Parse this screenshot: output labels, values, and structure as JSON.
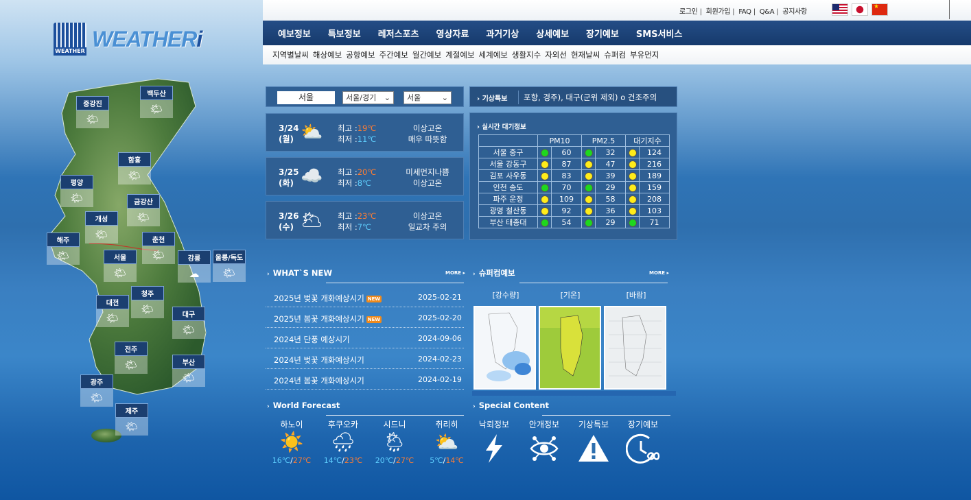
{
  "header": {
    "logo_text": "WEATHER",
    "logo_mark": "WEATHER",
    "util_links": [
      "로그인",
      "회원가입",
      "FAQ",
      "Q&A",
      "공지사항"
    ],
    "flags": [
      "us-flag",
      "jp-flag",
      "cn-flag"
    ]
  },
  "gnb": [
    "예보정보",
    "특보정보",
    "레저스포츠",
    "영상자료",
    "과거기상",
    "상세예보",
    "장기예보",
    "SMS서비스"
  ],
  "subnav": [
    "지역별날씨",
    "해상예보",
    "공항예보",
    "주간예보",
    "월간예보",
    "계절예보",
    "세계예보",
    "생활지수",
    "자외선",
    "현재날씨",
    "슈퍼컴",
    "부유먼지"
  ],
  "map_cities": [
    {
      "name": "중강진"
    },
    {
      "name": "백두산"
    },
    {
      "name": "함흥"
    },
    {
      "name": "평양"
    },
    {
      "name": "금강산"
    },
    {
      "name": "개성"
    },
    {
      "name": "해주"
    },
    {
      "name": "춘천"
    },
    {
      "name": "서울"
    },
    {
      "name": "강릉"
    },
    {
      "name": "울릉/독도"
    },
    {
      "name": "청주"
    },
    {
      "name": "대전"
    },
    {
      "name": "대구"
    },
    {
      "name": "전주"
    },
    {
      "name": "부산"
    },
    {
      "name": "광주"
    },
    {
      "name": "제주"
    }
  ],
  "location": {
    "city": "서울",
    "region_select": "서울/경기",
    "city_select": "서울"
  },
  "forecast_days": [
    {
      "date": "3/24",
      "weekday": "(월)",
      "icon": "partly-cloudy-icon",
      "hi_label": "최고 :",
      "hi": "19℃",
      "lo_label": "최저 :",
      "lo": "11℃",
      "desc1": "이상고온",
      "desc2": "매우 따뜻함"
    },
    {
      "date": "3/25",
      "weekday": "(화)",
      "icon": "cloudy-icon",
      "hi_label": "최고 :",
      "hi": "20℃",
      "lo_label": "최저 :",
      "lo": "8℃",
      "desc1": "미세먼지나쁨",
      "desc2": "이상고온"
    },
    {
      "date": "3/26",
      "weekday": "(수)",
      "icon": "sun-cloud-icon",
      "hi_label": "최고 :",
      "hi": "23℃",
      "lo_label": "최저 :",
      "lo": "7℃",
      "desc1": "이상고온",
      "desc2": "일교차 주의"
    }
  ],
  "alert": {
    "tag": "기상특보",
    "text": "포항, 경주), 대구(군위 제외) o 건조주의"
  },
  "air": {
    "title": "실시간 대기정보",
    "headers": [
      "PM10",
      "PM2.5",
      "대기지수"
    ],
    "rows": [
      {
        "place": "서울 중구",
        "pm10": "60",
        "pm10_c": "g",
        "pm25": "32",
        "pm25_c": "g",
        "aqi": "124",
        "aqi_c": "y"
      },
      {
        "place": "서울 강동구",
        "pm10": "87",
        "pm10_c": "y",
        "pm25": "47",
        "pm25_c": "y",
        "aqi": "216",
        "aqi_c": "y"
      },
      {
        "place": "김포 사우동",
        "pm10": "83",
        "pm10_c": "y",
        "pm25": "39",
        "pm25_c": "y",
        "aqi": "189",
        "aqi_c": "y"
      },
      {
        "place": "인천 송도",
        "pm10": "70",
        "pm10_c": "g",
        "pm25": "29",
        "pm25_c": "g",
        "aqi": "159",
        "aqi_c": "y"
      },
      {
        "place": "파주 운정",
        "pm10": "109",
        "pm10_c": "y",
        "pm25": "58",
        "pm25_c": "y",
        "aqi": "208",
        "aqi_c": "y"
      },
      {
        "place": "광명 철산동",
        "pm10": "92",
        "pm10_c": "y",
        "pm25": "36",
        "pm25_c": "y",
        "aqi": "103",
        "aqi_c": "y"
      },
      {
        "place": "부산 태종대",
        "pm10": "54",
        "pm10_c": "g",
        "pm25": "29",
        "pm25_c": "g",
        "aqi": "71",
        "aqi_c": "g"
      }
    ]
  },
  "whats_new": {
    "title": "WHAT`S NEW",
    "more": "MORE",
    "items": [
      {
        "title": "2025년 벚꽃 개화예상시기",
        "new": "NEW",
        "date": "2025-02-21"
      },
      {
        "title": "2025년 봄꽃 개화예상시기",
        "new": "NEW",
        "date": "2025-02-20"
      },
      {
        "title": "2024년 단풍 예상시기",
        "new": "",
        "date": "2024-09-06"
      },
      {
        "title": "2024년 벚꽃 개화예상시기",
        "new": "",
        "date": "2024-02-23"
      },
      {
        "title": "2024년 봄꽃 개화예상시기",
        "new": "",
        "date": "2024-02-19"
      }
    ]
  },
  "supercomputer": {
    "title": "슈퍼컴예보",
    "more": "MORE",
    "labels": [
      "[강수량]",
      "[기온]",
      "[바람]"
    ]
  },
  "world_forecast": {
    "title": "World Forecast",
    "cities": [
      {
        "name": "하노이",
        "icon": "sun-icon",
        "lo": "16℃",
        "hi": "27℃"
      },
      {
        "name": "후쿠오카",
        "icon": "rain-icon",
        "lo": "14℃",
        "hi": "23℃"
      },
      {
        "name": "시드니",
        "icon": "sun-cloud-rain-icon",
        "lo": "20℃",
        "hi": "27℃"
      },
      {
        "name": "취리히",
        "icon": "sun-cloud-icon",
        "lo": "5℃",
        "hi": "14℃"
      }
    ],
    "sep": "/"
  },
  "special_content": {
    "title": "Special Content",
    "items": [
      {
        "name": "낙뢰정보",
        "icon": "lightning-icon"
      },
      {
        "name": "안개정보",
        "icon": "fog-eye-icon"
      },
      {
        "name": "기상특보",
        "icon": "warning-icon"
      },
      {
        "name": "장기예보",
        "icon": "long-range-clock-icon"
      }
    ]
  },
  "colors": {
    "nav_bg": "#1b4276",
    "panel_bg": "#2f5f93",
    "hi_temp": "#ff7d33",
    "lo_temp": "#5fd0ff",
    "good": "#1ed81e",
    "moderate": "#ffec1a",
    "new_badge": "#f08a1c"
  }
}
